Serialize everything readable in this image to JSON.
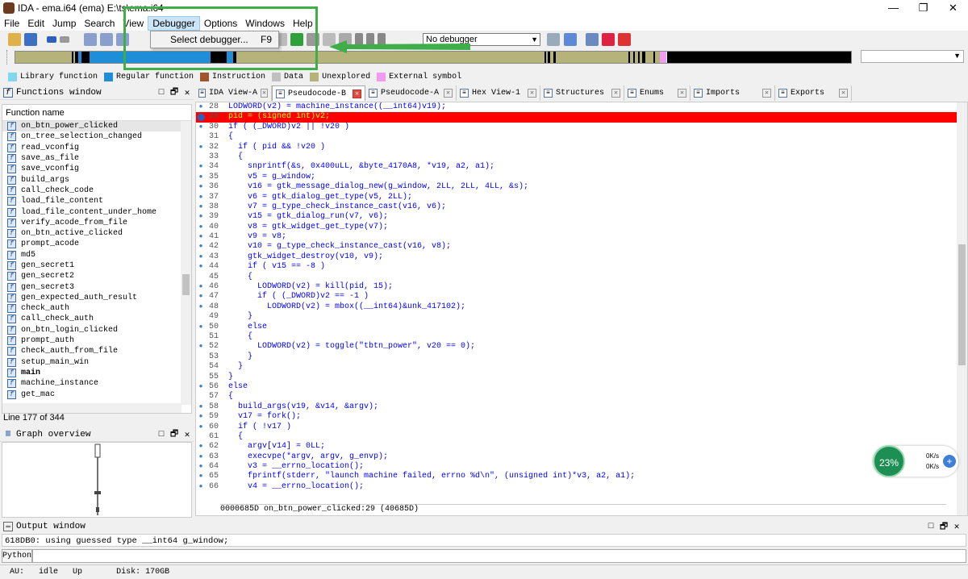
{
  "window": {
    "title": "IDA - ema.i64 (ema) E:\\ts\\ema.i64",
    "controls": [
      "—",
      "❐",
      "✕"
    ]
  },
  "menubar": [
    "File",
    "Edit",
    "Jump",
    "Search",
    "View",
    "Debugger",
    "Options",
    "Windows",
    "Help"
  ],
  "debugger_menu": {
    "item": "Select debugger...",
    "shortcut": "F9"
  },
  "toolbar": {
    "debugger_select": "No debugger"
  },
  "legend": [
    {
      "label": "Library function",
      "color": "#7fd7f0"
    },
    {
      "label": "Regular function",
      "color": "#1f8ed8"
    },
    {
      "label": "Instruction",
      "color": "#a1552c"
    },
    {
      "label": "Data",
      "color": "#c0c0c0"
    },
    {
      "label": "Unexplored",
      "color": "#b5b27a"
    },
    {
      "label": "External symbol",
      "color": "#f29bf2"
    }
  ],
  "functions_window": {
    "title": "Functions window",
    "column": "Function name",
    "items": [
      "on_btn_power_clicked",
      "on_tree_selection_changed",
      "read_vconfig",
      "save_as_file",
      "save_vconfig",
      "build_args",
      "call_check_code",
      "load_file_content",
      "load_file_content_under_home",
      "verify_acode_from_file",
      "on_btn_active_clicked",
      "prompt_acode",
      "md5",
      "gen_secret1",
      "gen_secret2",
      "gen_secret3",
      "gen_expected_auth_result",
      "check_auth",
      "call_check_auth",
      "on_btn_login_clicked",
      "prompt_auth",
      "check_auth_from_file",
      "setup_main_win",
      "main",
      "machine_instance",
      "get_mac"
    ],
    "status": "Line 177 of 344"
  },
  "graph_overview": {
    "title": "Graph overview"
  },
  "tabs": [
    {
      "label": "IDA View-A"
    },
    {
      "label": "Pseudocode-B"
    },
    {
      "label": "Pseudocode-A"
    },
    {
      "label": "Hex View-1"
    },
    {
      "label": "Structures"
    },
    {
      "label": "Enums"
    },
    {
      "label": "Imports"
    },
    {
      "label": "Exports"
    }
  ],
  "code": {
    "lines": [
      {
        "n": "28",
        "t": "LODWORD(v2) = machine_instance((__int64)v19);"
      },
      {
        "n": "29",
        "t": "pid = (signed int)v2;"
      },
      {
        "n": "30",
        "t": "if ( (_DWORD)v2 || !v20 )"
      },
      {
        "n": "31",
        "t": "{"
      },
      {
        "n": "32",
        "t": "  if ( pid && !v20 )"
      },
      {
        "n": "33",
        "t": "  {"
      },
      {
        "n": "34",
        "t": "    snprintf(&s, 0x400uLL, &byte_4170A8, *v19, a2, a1);"
      },
      {
        "n": "35",
        "t": "    v5 = g_window;"
      },
      {
        "n": "36",
        "t": "    v16 = gtk_message_dialog_new(g_window, 2LL, 2LL, 4LL, &s);"
      },
      {
        "n": "37",
        "t": "    v6 = gtk_dialog_get_type(v5, 2LL);"
      },
      {
        "n": "38",
        "t": "    v7 = g_type_check_instance_cast(v16, v6);"
      },
      {
        "n": "39",
        "t": "    v15 = gtk_dialog_run(v7, v6);"
      },
      {
        "n": "40",
        "t": "    v8 = gtk_widget_get_type(v7);"
      },
      {
        "n": "41",
        "t": "    v9 = v8;"
      },
      {
        "n": "42",
        "t": "    v10 = g_type_check_instance_cast(v16, v8);"
      },
      {
        "n": "43",
        "t": "    gtk_widget_destroy(v10, v9);"
      },
      {
        "n": "44",
        "t": "    if ( v15 == -8 )"
      },
      {
        "n": "45",
        "t": "    {"
      },
      {
        "n": "46",
        "t": "      LODWORD(v2) = kill(pid, 15);"
      },
      {
        "n": "47",
        "t": "      if ( (_DWORD)v2 == -1 )"
      },
      {
        "n": "48",
        "t": "        LODWORD(v2) = mbox((__int64)&unk_417102);"
      },
      {
        "n": "49",
        "t": "    }"
      },
      {
        "n": "50",
        "t": "    else"
      },
      {
        "n": "51",
        "t": "    {"
      },
      {
        "n": "52",
        "t": "      LODWORD(v2) = toggle(\"tbtn_power\", v20 == 0);"
      },
      {
        "n": "53",
        "t": "    }"
      },
      {
        "n": "54",
        "t": "  }"
      },
      {
        "n": "55",
        "t": "}"
      },
      {
        "n": "56",
        "t": "else"
      },
      {
        "n": "57",
        "t": "{"
      },
      {
        "n": "58",
        "t": "  build_args(v19, &v14, &argv);"
      },
      {
        "n": "59",
        "t": "  v17 = fork();"
      },
      {
        "n": "60",
        "t": "  if ( !v17 )"
      },
      {
        "n": "61",
        "t": "  {"
      },
      {
        "n": "62",
        "t": "    argv[v14] = 0LL;"
      },
      {
        "n": "63",
        "t": "    execvpe(*argv, argv, g_envp);"
      },
      {
        "n": "64",
        "t": "    v3 = __errno_location();"
      },
      {
        "n": "65",
        "t": "    fprintf(stderr, \"launch machine failed, errno %d\\n\", (unsigned int)*v3, a2, a1);"
      },
      {
        "n": "66",
        "t": "    v4 = __errno_location();"
      }
    ],
    "status": "0000685D on_btn_power_clicked:29 (40685D)"
  },
  "speed_widget": {
    "percent": "23%",
    "up": "0K/s",
    "down": "0K/s"
  },
  "output_window": {
    "title": "Output window",
    "text": "618DB0: using guessed type __int64 g_window;",
    "python_label": "Python"
  },
  "statusbar": {
    "au": "AU:",
    "state": "idle",
    "dir": "Up",
    "disk": "Disk: 170GB"
  }
}
